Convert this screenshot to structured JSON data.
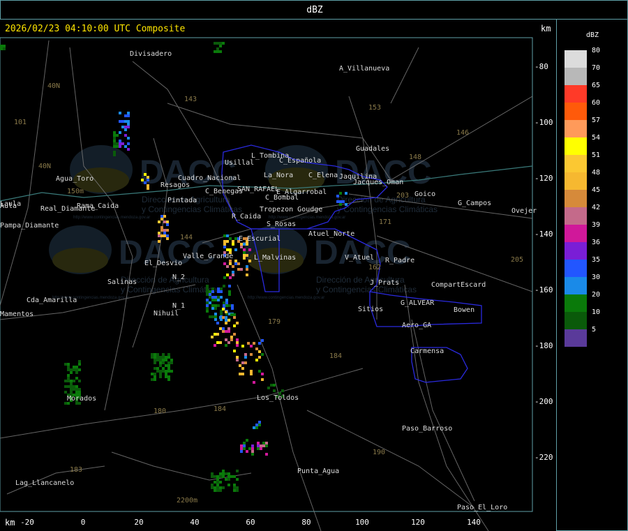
{
  "title": "dBZ",
  "timestamp": "2026/02/23 04:10:00 UTC Composite",
  "axis_unit_top": "km",
  "axis_unit_bottom": "km",
  "y_ticks": [
    "-80",
    "-100",
    "-120",
    "-140",
    "-160",
    "-180",
    "-200",
    "-220"
  ],
  "x_ticks": [
    "-20",
    "0",
    "20",
    "40",
    "60",
    "80",
    "100",
    "120",
    "140"
  ],
  "legend": {
    "unit": "dBZ",
    "bins": [
      {
        "label": "80",
        "color": "#dcdcdc"
      },
      {
        "label": "70",
        "color": "#b8b8b8"
      },
      {
        "label": "65",
        "color": "#ff3a28"
      },
      {
        "label": "60",
        "color": "#ff5a0a"
      },
      {
        "label": "57",
        "color": "#ff9a5a"
      },
      {
        "label": "54",
        "color": "#ffff00"
      },
      {
        "label": "51",
        "color": "#fbc832"
      },
      {
        "label": "48",
        "color": "#f6b830"
      },
      {
        "label": "45",
        "color": "#d68a3a"
      },
      {
        "label": "42",
        "color": "#c46a8a"
      },
      {
        "label": "39",
        "color": "#d0189a"
      },
      {
        "label": "36",
        "color": "#7a1ed6"
      },
      {
        "label": "35",
        "color": "#2256ff"
      },
      {
        "label": "30",
        "color": "#1a8ae8"
      },
      {
        "label": "20",
        "color": "#0a7a0a"
      },
      {
        "label": "10",
        "color": "#0a5a0a"
      },
      {
        "label": "5",
        "color": "#5a3a9a"
      }
    ]
  },
  "watermark": {
    "brand": "DACC",
    "line1": "Dirección de Agricultura",
    "line2": "y Contingencias Climáticas",
    "url": "http://www.contingencias.mendoza.gov.ar"
  },
  "places": [
    {
      "name": "Divisadero"
    },
    {
      "name": "A_Villanueva"
    },
    {
      "name": "Guadales"
    },
    {
      "name": "Agua_Toro"
    },
    {
      "name": "Real_Diamante"
    },
    {
      "name": "Rama_Caida"
    },
    {
      "name": "Pampa_Diamante"
    },
    {
      "name": "Pintada"
    },
    {
      "name": "Resagos"
    },
    {
      "name": "Cuadro_Nacional"
    },
    {
      "name": "Usillal"
    },
    {
      "name": "L_Tombina"
    },
    {
      "name": "La_Nora"
    },
    {
      "name": "C_Española"
    },
    {
      "name": "C_Elena"
    },
    {
      "name": "Jaquilina"
    },
    {
      "name": "Jacques_Oman"
    },
    {
      "name": "C_Benegas"
    },
    {
      "name": "SAN_RAFAEL"
    },
    {
      "name": "E_Algarrobal"
    },
    {
      "name": "C_Bombal"
    },
    {
      "name": "Tropezon Goudge"
    },
    {
      "name": "R_Caida"
    },
    {
      "name": "Goico"
    },
    {
      "name": "G_Campos"
    },
    {
      "name": "Ovejer"
    },
    {
      "name": "S_Rosas"
    },
    {
      "name": "Atuel_Norte"
    },
    {
      "name": "E_Escurial"
    },
    {
      "name": "Valle_Grande"
    },
    {
      "name": "El_Desvio"
    },
    {
      "name": "L_Malvinas"
    },
    {
      "name": "V_Atuel"
    },
    {
      "name": "R_Padre"
    },
    {
      "name": "J_Prats"
    },
    {
      "name": "CompartEscard"
    },
    {
      "name": "Salinas"
    },
    {
      "name": "N_2"
    },
    {
      "name": "N_1"
    },
    {
      "name": "Nihuil"
    },
    {
      "name": "Cda_Amarilla"
    },
    {
      "name": "Sitios"
    },
    {
      "name": "G_ALVEAR"
    },
    {
      "name": "Bowen"
    },
    {
      "name": "Aero_GA"
    },
    {
      "name": "Carmensa"
    },
    {
      "name": "Morados"
    },
    {
      "name": "Los_Toldos"
    },
    {
      "name": "Paso_Barroso"
    },
    {
      "name": "Punta_Agua"
    },
    {
      "name": "Lag_Llancanelo"
    },
    {
      "name": "Paso_El_Loro"
    },
    {
      "name": "Mamentos"
    },
    {
      "name": "Laula"
    },
    {
      "name": "Aula"
    }
  ],
  "route_labels": [
    "40N",
    "101",
    "143",
    "153",
    "146",
    "148",
    "203",
    "171",
    "205",
    "144",
    "162",
    "179",
    "184",
    "180",
    "183",
    "190",
    "40N",
    "150m",
    "2200m",
    "184"
  ]
}
